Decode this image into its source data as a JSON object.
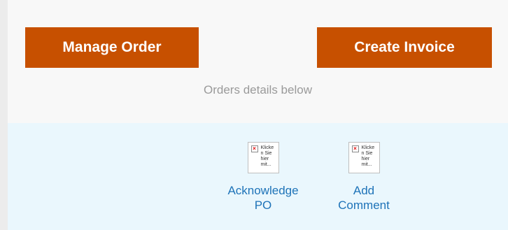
{
  "buttons": {
    "manage_order": "Manage Order",
    "create_invoice": "Create Invoice"
  },
  "subtitle": "Orders details below",
  "actions": [
    {
      "image_alt_text": "Klicken Sie hier mit...",
      "alt_lines": [
        "Klicke",
        "n Sie",
        "hier",
        "mit..."
      ],
      "label_lines": [
        "Acknowledge",
        "PO"
      ]
    },
    {
      "image_alt_text": "Klicken Sie hier mit...",
      "alt_lines": [
        "Klicke",
        "n Sie",
        "hier",
        "mit..."
      ],
      "label_lines": [
        "Add",
        "Comment"
      ]
    }
  ],
  "colors": {
    "button_bg": "#c75000",
    "link": "#1e73b8",
    "bottom_panel": "#eaf7fd"
  }
}
